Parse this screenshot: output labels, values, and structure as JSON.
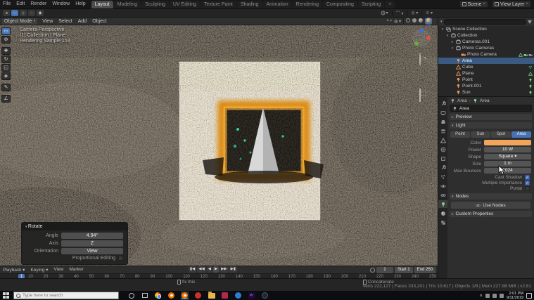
{
  "topbar": {
    "menus": [
      "File",
      "Edit",
      "Render",
      "Window",
      "Help"
    ],
    "tabs": [
      "Layout",
      "Modeling",
      "Sculpting",
      "UV Editing",
      "Texture Paint",
      "Shading",
      "Animation",
      "Rendering",
      "Compositing",
      "Scripting",
      "+"
    ],
    "active_tab": "Layout",
    "scene_label": "Scene",
    "view_layer_label": "View Layer"
  },
  "viewport": {
    "mode": "Object Mode",
    "menus": [
      "View",
      "Select",
      "Add",
      "Object"
    ],
    "overlay_lines": [
      "Camera Perspective",
      "(1) Collection | Plane",
      "Rendering Sample 153"
    ],
    "toolbar_icons": [
      "select-box-tool",
      "cursor-tool",
      "move-tool",
      "rotate-tool",
      "scale-tool",
      "transform-tool",
      "annotate-tool",
      "measure-tool"
    ],
    "shading_modes": [
      "wireframe",
      "solid",
      "material-preview",
      "rendered"
    ],
    "active_shading": "rendered",
    "rotate_panel": {
      "title": "Rotate",
      "fields": [
        {
          "label": "Angle",
          "value": "4.94°"
        },
        {
          "label": "Axis",
          "value": "Z"
        },
        {
          "label": "Orientation",
          "value": "View"
        }
      ],
      "checkbox_label": "Proportional Editing",
      "checkbox_checked": false
    }
  },
  "outliner": {
    "rows": [
      {
        "label": "Scene Collection",
        "icon": "scene-collection",
        "depth": 0,
        "expanded": true
      },
      {
        "label": "Collection",
        "icon": "collection",
        "depth": 1,
        "expanded": true
      },
      {
        "label": "Cameras.001",
        "icon": "collection",
        "depth": 2,
        "expanded": false
      },
      {
        "label": "Photo Cameras",
        "icon": "collection",
        "depth": 2,
        "expanded": true
      },
      {
        "label": "Photo Camera",
        "icon": "camera",
        "depth": 3,
        "badges": [
          "mesh-data",
          "camera-data",
          "render-toggle"
        ]
      },
      {
        "label": "Area",
        "icon": "light",
        "depth": 2,
        "selected": true
      },
      {
        "label": "Cube",
        "icon": "mesh",
        "depth": 2,
        "badges": [
          "particles"
        ]
      },
      {
        "label": "Plane",
        "icon": "mesh",
        "depth": 2,
        "badges": [
          "mesh-data"
        ]
      },
      {
        "label": "Point",
        "icon": "light",
        "depth": 2,
        "badges": [
          "light-data"
        ]
      },
      {
        "label": "Point.001",
        "icon": "light",
        "depth": 2,
        "badges": [
          "light-data"
        ]
      },
      {
        "label": "Sun",
        "icon": "light",
        "depth": 2,
        "badges": [
          "light-data"
        ]
      }
    ]
  },
  "properties": {
    "breadcrumb": [
      "Area",
      "Area"
    ],
    "name_value": "Area",
    "tabs": [
      "tool",
      "render",
      "output",
      "view-layer",
      "scene",
      "world",
      "object",
      "modifiers",
      "particles",
      "physics",
      "constraints",
      "object-data",
      "material",
      "texture"
    ],
    "active_tab": "object-data",
    "preview_section": "Preview",
    "light_section": "Light",
    "light_types": [
      "Point",
      "Sun",
      "Spot",
      "Area"
    ],
    "active_light_type": "Area",
    "fields": [
      {
        "label": "Color",
        "type": "color",
        "value": "#f0a45c"
      },
      {
        "label": "Power",
        "value": "10 W"
      },
      {
        "label": "Shape",
        "value": "Square",
        "dropdown": true
      },
      {
        "label": "Size",
        "value": "1 m"
      },
      {
        "label": "Max Bounces",
        "value": "1024"
      }
    ],
    "checkboxes": [
      {
        "label": "Cast Shadow",
        "checked": true
      },
      {
        "label": "Multiple Importance",
        "checked": true
      },
      {
        "label": "Portal",
        "checked": false
      }
    ],
    "nodes_section": "Nodes",
    "use_nodes_button": "Use Nodes",
    "custom_properties_section": "Custom Properties"
  },
  "timeline": {
    "menus": [
      "Playback",
      "Keying",
      "View",
      "Marker"
    ],
    "current_frame": "1",
    "start_label": "Start",
    "start_value": "1",
    "end_label": "End",
    "end_value": "250",
    "ticks": [
      10,
      20,
      30,
      40,
      50,
      60,
      70,
      80,
      90,
      100,
      110,
      120,
      130,
      140,
      150,
      160,
      170,
      180,
      190,
      200,
      210,
      220,
      230,
      240,
      250
    ]
  },
  "statusbar": {
    "hints": [
      "fix this",
      "Concatenate"
    ],
    "stats": "Verts 222,127 | Faces 333,201 | Tris 10,617 | Objects 1/8 | Mem 227.88 MiB | v2.81"
  },
  "taskbar": {
    "search_placeholder": "Type here to search",
    "icons": [
      "cortana",
      "task-view",
      "chrome",
      "blender",
      "blender-active",
      "app-red",
      "file-explorer",
      "app-crimson",
      "app-blue",
      "premiere",
      "app-dark"
    ],
    "clock_time": "2:01 PM",
    "clock_date": "9/11/2019"
  },
  "colors": {
    "accent": "#4772b3",
    "selection": "#3b5a82",
    "light_swatch": "#f0a45c"
  }
}
